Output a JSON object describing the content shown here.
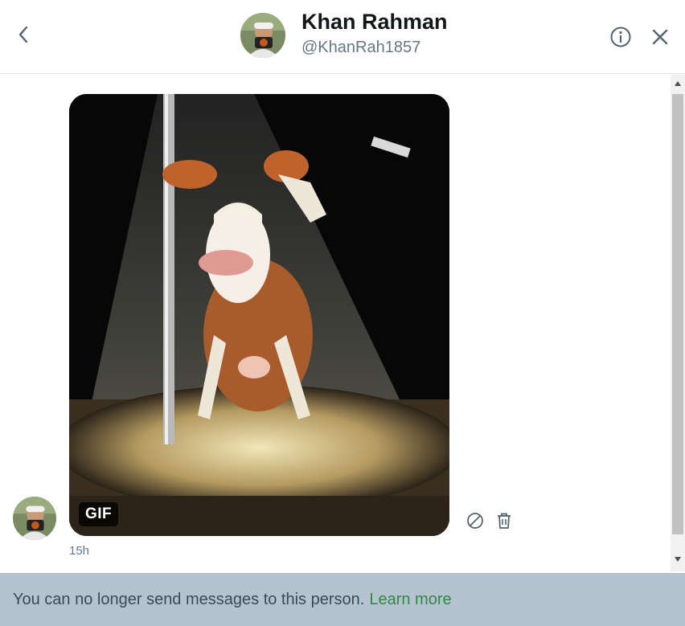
{
  "header": {
    "name": "Khan Rahman",
    "handle": "@KhanRah1857",
    "back_icon": "chevron-left-icon",
    "info_icon": "info-icon",
    "close_icon": "close-icon"
  },
  "conversation": {
    "messages": [
      {
        "type": "gif",
        "media_description_icon": "gif-media",
        "badge": "GIF",
        "time": "15h",
        "actions": [
          "report-icon",
          "trash-icon"
        ]
      }
    ]
  },
  "footer": {
    "notice": "You can no longer send messages to this person.",
    "link": "Learn more"
  },
  "colors": {
    "link_green": "#2e8b3e",
    "footer_bg": "#b4c3cf",
    "handle_gray": "#657786"
  }
}
